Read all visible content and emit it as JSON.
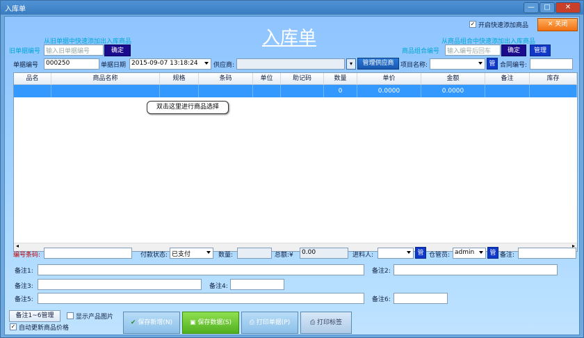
{
  "window": {
    "title": "入库单"
  },
  "header": {
    "page_title": "入库单",
    "quick_add_label": "开启快速添加商品",
    "quick_add_checked": "✓",
    "close_label": "关闭"
  },
  "old_order": {
    "hint": "从旧单据中快速添加出入库商品",
    "label": "旧单据编号",
    "placeholder": "输入旧单据编号",
    "confirm": "确定"
  },
  "combo": {
    "hint": "从商品组合中快速添加出入库商品",
    "label": "商品组合编号",
    "placeholder": "输入编号后回车",
    "confirm": "确定",
    "manage": "管理"
  },
  "form": {
    "doc_no_label": "单据编号",
    "doc_no_value": "000250",
    "doc_date_label": "单据日期",
    "doc_date_value": "2015-09-07 13:18:24",
    "supplier_label": "供应商:",
    "manage_supplier": "管理供应商",
    "project_label": "项目名称:",
    "project_manage": "管",
    "contract_label": "合同编号:"
  },
  "grid": {
    "columns": [
      "品名",
      "商品名称",
      "规格",
      "条码",
      "单位",
      "助记码",
      "数量",
      "单价",
      "金额",
      "备注",
      "库存"
    ],
    "row": [
      "",
      "",
      "",
      "",
      "",
      "",
      "0",
      "0.0000",
      "0.0000",
      "",
      ""
    ]
  },
  "tooltip": "双击这里进行商品选择",
  "footer": {
    "barcode_label": "编号条码:",
    "pay_status_label": "付款状态:",
    "pay_status_value": "已支付",
    "quantity_label": "数量:",
    "total_label": "总额:¥",
    "total_value": "0.00",
    "purchaser_label": "进料人:",
    "purchaser_manage": "管",
    "keeper_label": "仓管员:",
    "keeper_value": "admin",
    "keeper_manage": "管",
    "remark_label": "备注:",
    "note1": "备注1:",
    "note2": "备注2:",
    "note3": "备注3:",
    "note4": "备注4:",
    "note5": "备注5:",
    "note6": "备注6:"
  },
  "bottom": {
    "notes_manage": "备注1~6管理",
    "show_image": "显示产品图片",
    "auto_update": "自动更新商品价格",
    "auto_update_checked": "✓",
    "save_new": "保存新增(N)",
    "save_data": "保存数据(S)",
    "print_doc": "打印单据(P)",
    "print_label": "打印标签"
  }
}
